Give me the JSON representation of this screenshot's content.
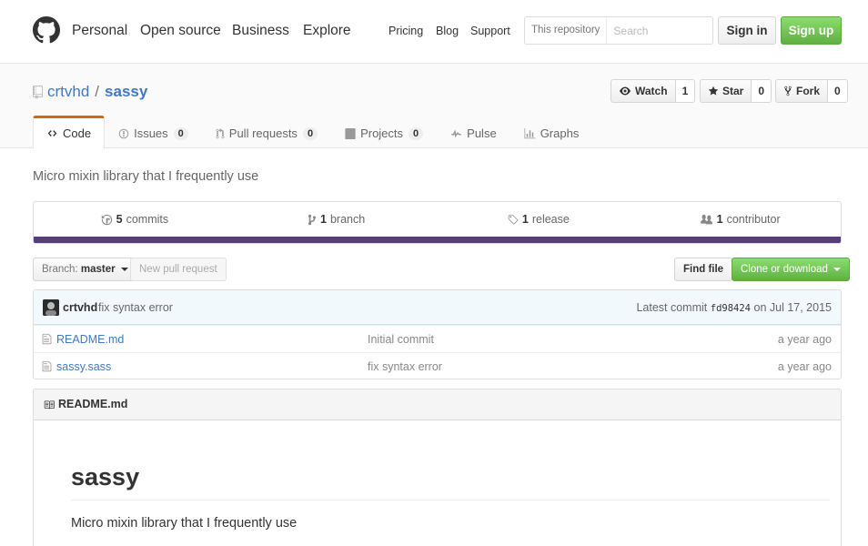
{
  "header": {
    "nav": [
      "Personal",
      "Open source",
      "Business",
      "Explore"
    ],
    "subnav": [
      "Pricing",
      "Blog",
      "Support"
    ],
    "search": {
      "scope": "This repository",
      "placeholder": "Search"
    },
    "signin_label": "Sign in",
    "signup_label": "Sign up"
  },
  "repo": {
    "owner": "crtvhd",
    "separator": "/",
    "name": "sassy",
    "description": "Micro mixin library that I frequently use"
  },
  "actions": {
    "watch": {
      "label": "Watch",
      "count": "1",
      "icon": "eye-icon"
    },
    "star": {
      "label": "Star",
      "count": "0",
      "icon": "star-icon"
    },
    "fork": {
      "label": "Fork",
      "count": "0",
      "icon": "fork-icon"
    }
  },
  "tabs": [
    {
      "label": "Code",
      "icon": "code-icon",
      "selected": true
    },
    {
      "label": "Issues",
      "count": "0",
      "icon": "issue-icon"
    },
    {
      "label": "Pull requests",
      "count": "0",
      "icon": "pull-request-icon"
    },
    {
      "label": "Projects",
      "count": "0",
      "icon": "project-icon"
    },
    {
      "label": "Pulse",
      "icon": "pulse-icon"
    },
    {
      "label": "Graphs",
      "icon": "graph-icon"
    }
  ],
  "summary": {
    "commits": {
      "num": "5",
      "label": "commits"
    },
    "branches": {
      "num": "1",
      "label": "branch"
    },
    "releases": {
      "num": "1",
      "label": "release"
    },
    "contributors": {
      "num": "1",
      "label": "contributor"
    },
    "language_color": "#563d7c"
  },
  "file_nav": {
    "branch_prefix": "Branch:",
    "branch": "master",
    "new_pr": "New pull request",
    "find_file": "Find file",
    "clone": "Clone or download"
  },
  "latest_commit": {
    "author": "crtvhd",
    "message": "fix syntax error",
    "prefix": "Latest commit",
    "sha": "fd98424",
    "date": "on Jul 17, 2015"
  },
  "files": [
    {
      "name": "README.md",
      "message": "Initial commit",
      "age": "a year ago"
    },
    {
      "name": "sassy.sass",
      "message": "fix syntax error",
      "age": "a year ago"
    }
  ],
  "readme": {
    "filename": "README.md",
    "heading": "sassy",
    "body": "Micro mixin library that I frequently use"
  }
}
